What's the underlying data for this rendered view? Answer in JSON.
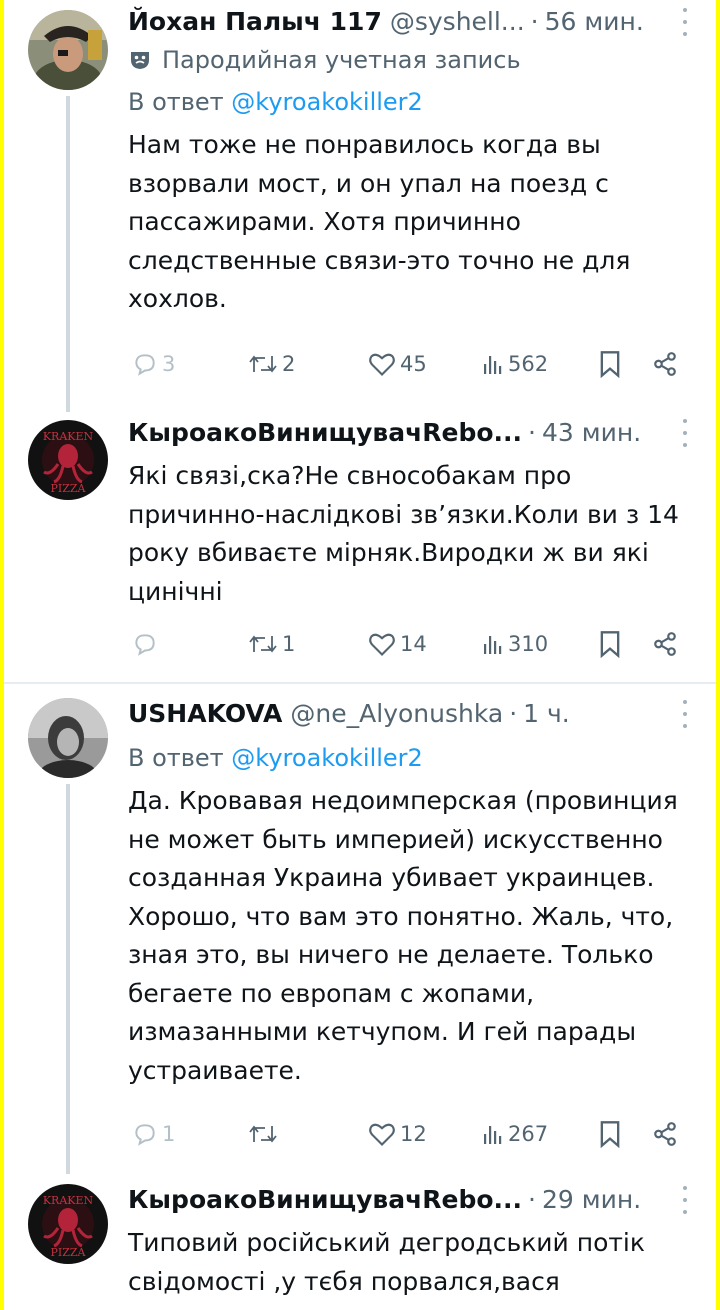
{
  "colors": {
    "accent": "#1d9bf0",
    "secondary_text": "#536471",
    "page_border": "#ffff00"
  },
  "tweets": [
    {
      "name": "Йохан Палыч 117",
      "handle": "@syshell...",
      "time": "56 мин.",
      "parody_label": "Пародийная учетная запись",
      "reply_prefix": "В ответ",
      "reply_to": "@kyroakokiller2",
      "text": "Нам тоже не понравилось когда вы взорвали мост, и он упал на поезд с пассажирами. Хотя причинно следственные связи-это точно не для хохлов.",
      "replies": "3",
      "retweets": "2",
      "likes": "45",
      "views": "562",
      "avatar_icon": "pirate-avatar"
    },
    {
      "name": "КыроакоВинищувачRebo...",
      "time": "43 мин.",
      "text": "Які связі,ска?Не свнособакам про причинно-наслідкові  зв’язки.Коли ви з 14 року вбиваєте мірняк.Виродки ж ви які цинічні",
      "replies": "",
      "retweets": "1",
      "likes": "14",
      "views": "310",
      "avatar_icon": "kraken-pizza-avatar",
      "avatar_text_top": "KRAKEN",
      "avatar_text_bottom": "PIZZA"
    },
    {
      "name": "USHAKOVA",
      "handle": "@ne_Alyonushka",
      "time": "1 ч.",
      "reply_prefix": "В ответ",
      "reply_to": "@kyroakokiller2",
      "text": "Да. Кровавая недоимперская (провинция не может быть империей) искусственно созданная Украина убивает украинцев. Хорошо, что вам это понятно. Жаль, что, зная это, вы ничего не делаете. Только бегаете по европам с жопами, измазанными кетчупом. И гей парады устраиваете.",
      "replies": "1",
      "retweets": "",
      "likes": "12",
      "views": "267",
      "avatar_icon": "grayscale-photo-avatar"
    },
    {
      "name": "КыроакоВинищувачRebo...",
      "time": "29 мин.",
      "text": "Типовий російський дегродський потік свідомості ,у тєбя порвался,вася",
      "avatar_icon": "kraken-pizza-avatar",
      "avatar_text_top": "KRAKEN",
      "avatar_text_bottom": "PIZZA"
    }
  ]
}
